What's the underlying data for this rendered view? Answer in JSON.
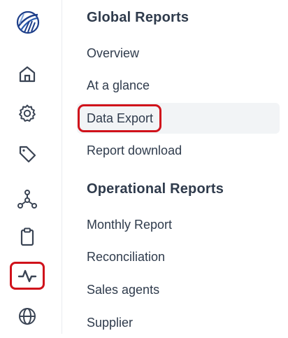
{
  "rail": {
    "icons": [
      {
        "name": "logo-icon"
      },
      {
        "name": "home-icon"
      },
      {
        "name": "gear-icon"
      },
      {
        "name": "tag-icon"
      },
      {
        "name": "network-icon"
      },
      {
        "name": "clipboard-icon"
      },
      {
        "name": "activity-icon",
        "active": true
      },
      {
        "name": "globe-icon"
      }
    ],
    "colors": {
      "icon": "#3a4454",
      "active_outline": "#d0121b"
    }
  },
  "menu": {
    "global": {
      "title": "Global Reports",
      "items": [
        "Overview",
        "At a glance",
        "Data Export",
        "Report download"
      ],
      "selected": "Data Export"
    },
    "operational": {
      "title": "Operational Reports",
      "items": [
        "Monthly Report",
        "Reconciliation",
        "Sales agents",
        "Supplier"
      ]
    }
  }
}
